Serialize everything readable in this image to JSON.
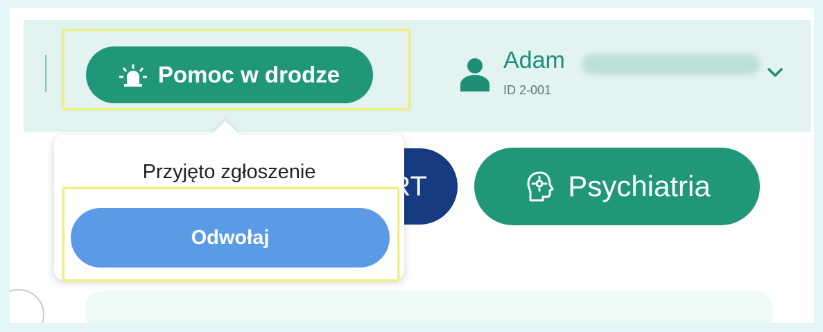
{
  "header": {
    "help_button_label": "Pomoc w drodze",
    "user": {
      "first_name": "Adam",
      "id_label": "ID 2-001"
    }
  },
  "tabs": {
    "partial_tab_fragment": "RT",
    "psychiatry_label": "Psychiatria"
  },
  "popup": {
    "message": "Przyjęto zgłoszenie",
    "cancel_label": "Odwołaj"
  },
  "icons": {
    "help": "siren-icon",
    "user": "person-icon",
    "menu": "chevron-down-icon",
    "psychiatry": "head-gear-icon"
  },
  "colors": {
    "primary_green": "#21977a",
    "header_bg": "#e2f3f1",
    "cancel_blue": "#5b9be6",
    "navy": "#173b80",
    "highlight_yellow": "#eef07e"
  }
}
